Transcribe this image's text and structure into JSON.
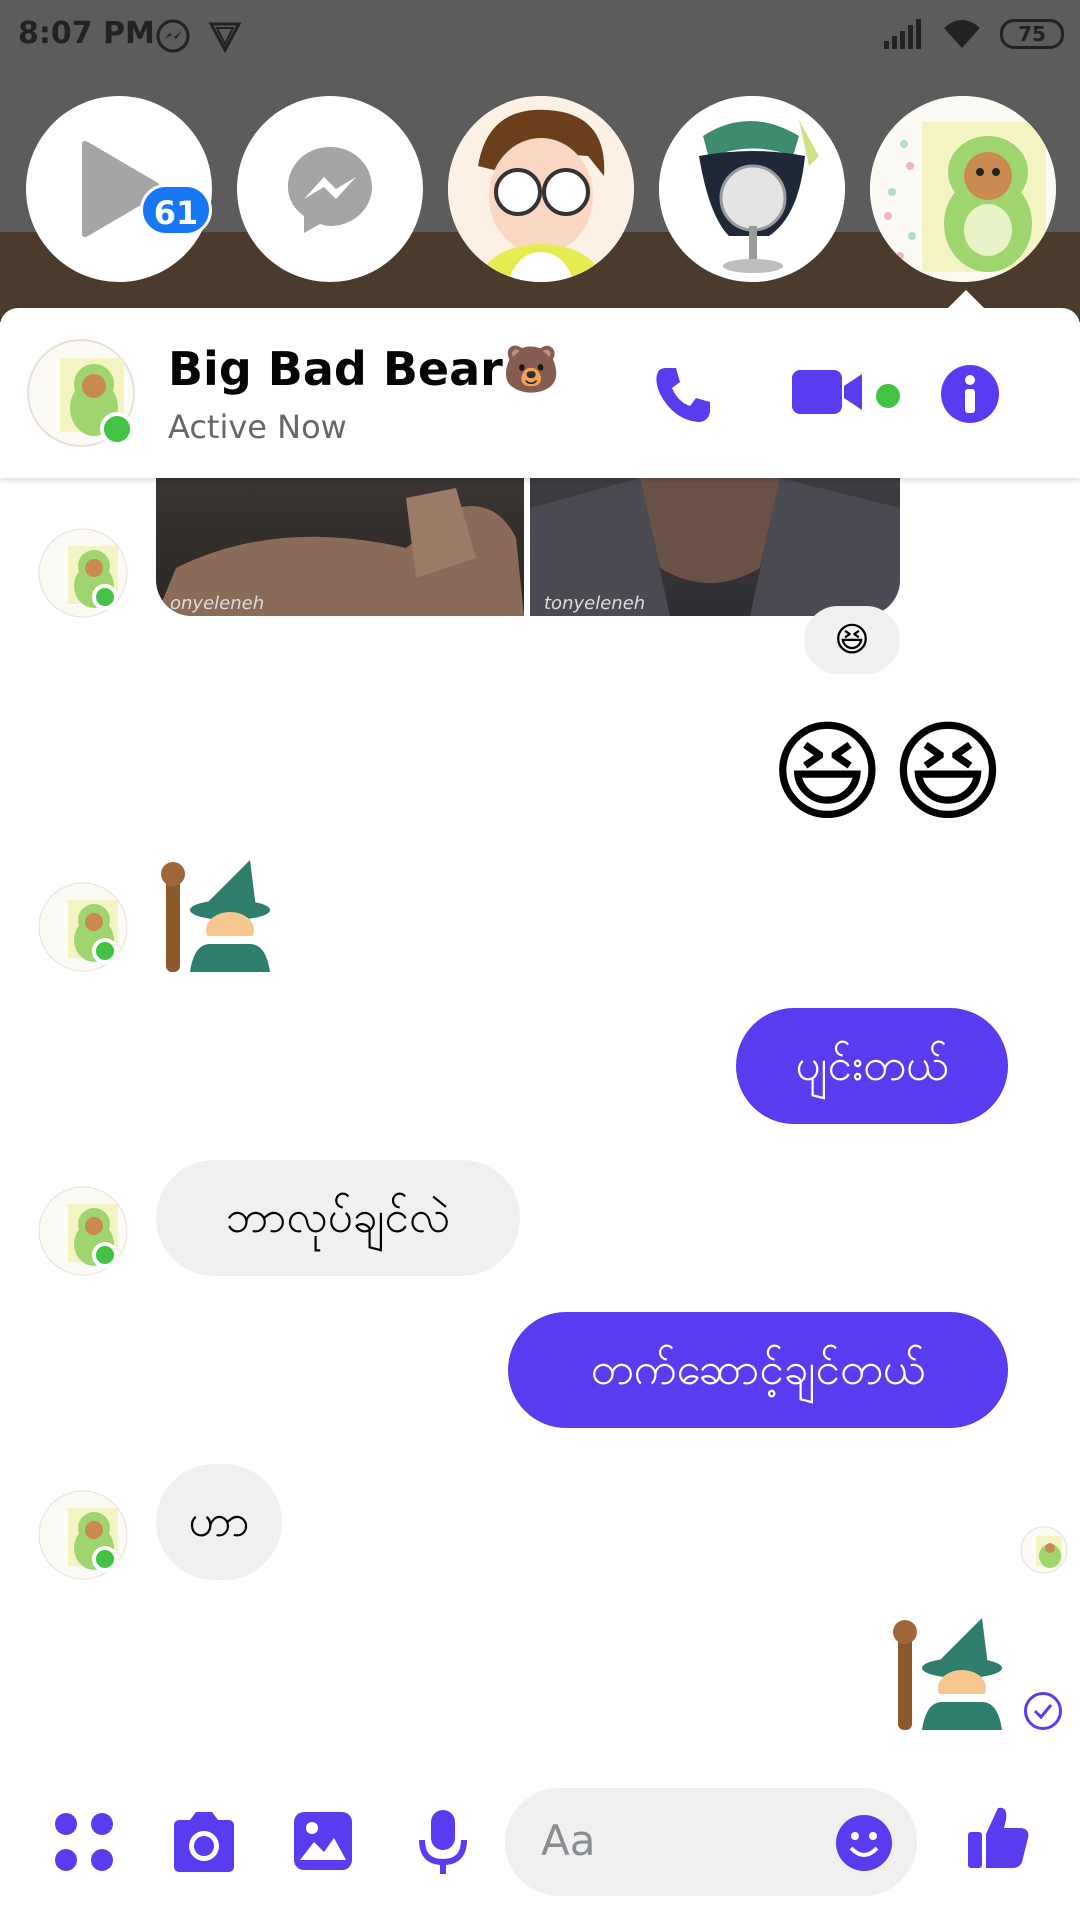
{
  "status_bar": {
    "time": "8:07 PM",
    "battery": "75"
  },
  "chat_heads": {
    "badge_count": "61"
  },
  "header": {
    "name": "Big Bad Bear🐻",
    "status": "Active Now"
  },
  "messages": {
    "photo_watermark_left": "onyeleneh",
    "photo_watermark_right": "tonyeleneh",
    "reaction": "😆",
    "outgoing_emoji": "😆😆",
    "out_1": "ပျင်းတယ်",
    "in_1": "ဘာလုပ်ချင်လဲ",
    "out_2": "တက်ဆောင့်ချင်တယ်",
    "in_2": "ဟာ"
  },
  "composer": {
    "placeholder": "Aa"
  },
  "colors": {
    "accent": "#5b3bf0",
    "online": "#44c246",
    "badge": "#1877f2"
  }
}
